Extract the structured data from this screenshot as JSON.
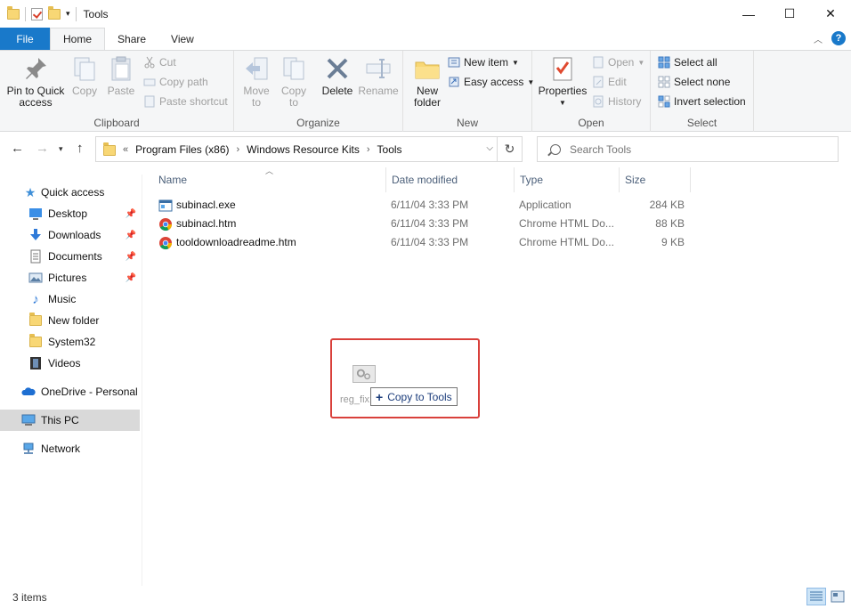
{
  "window": {
    "title": "Tools",
    "controls": {
      "minimize": "—",
      "maximize": "☐",
      "close": "✕"
    }
  },
  "ribbon_tabs": [
    {
      "label": "File"
    },
    {
      "label": "Home"
    },
    {
      "label": "Share"
    },
    {
      "label": "View"
    }
  ],
  "ribbon": {
    "clipboard": {
      "label": "Clipboard",
      "pin": "Pin to Quick\naccess",
      "pin_l1": "Pin to Quick",
      "pin_l2": "access",
      "copy": "Copy",
      "paste": "Paste",
      "cut": "Cut",
      "copy_path": "Copy path",
      "paste_shortcut": "Paste shortcut"
    },
    "organize": {
      "label": "Organize",
      "move_l1": "Move",
      "move_l2": "to",
      "copy_l1": "Copy",
      "copy_l2": "to",
      "delete": "Delete",
      "rename": "Rename"
    },
    "new": {
      "label": "New",
      "folder_l1": "New",
      "folder_l2": "folder",
      "new_item": "New item",
      "easy_access": "Easy access"
    },
    "open": {
      "label": "Open",
      "properties": "Properties",
      "open": "Open",
      "edit": "Edit",
      "history": "History"
    },
    "select": {
      "label": "Select",
      "select_all": "Select all",
      "select_none": "Select none",
      "invert": "Invert selection"
    }
  },
  "address": {
    "overflow": "«",
    "crumbs": [
      "Program Files (x86)",
      "Windows Resource Kits",
      "Tools"
    ],
    "search_placeholder": "Search Tools"
  },
  "nav": {
    "quick_access": "Quick access",
    "items": [
      {
        "label": "Desktop",
        "pinned": true
      },
      {
        "label": "Downloads",
        "pinned": true
      },
      {
        "label": "Documents",
        "pinned": true
      },
      {
        "label": "Pictures",
        "pinned": true
      },
      {
        "label": "Music",
        "pinned": false
      },
      {
        "label": "New folder",
        "pinned": false
      },
      {
        "label": "System32",
        "pinned": false
      },
      {
        "label": "Videos",
        "pinned": false
      }
    ],
    "onedrive": "OneDrive - Personal",
    "this_pc": "This PC",
    "network": "Network"
  },
  "columns": {
    "name": "Name",
    "date": "Date modified",
    "type": "Type",
    "size": "Size"
  },
  "files": [
    {
      "name": "subinacl.exe",
      "date": "6/11/04 3:33 PM",
      "type": "Application",
      "size": "284 KB",
      "icon": "exe-icon"
    },
    {
      "name": "subinacl.htm",
      "date": "6/11/04 3:33 PM",
      "type": "Chrome HTML Do...",
      "size": "88 KB",
      "icon": "chrome-icon"
    },
    {
      "name": "tooldownloadreadme.htm",
      "date": "6/11/04 3:33 PM",
      "type": "Chrome HTML Do...",
      "size": "9 KB",
      "icon": "chrome-icon"
    }
  ],
  "drag": {
    "ghost_label": "reg_fix",
    "tooltip": "Copy to Tools",
    "highlight_color": "#d9403b"
  },
  "status": {
    "items": "3 items"
  },
  "colors": {
    "accent": "#1979ca",
    "selected_nav": "#d9d9d9"
  }
}
